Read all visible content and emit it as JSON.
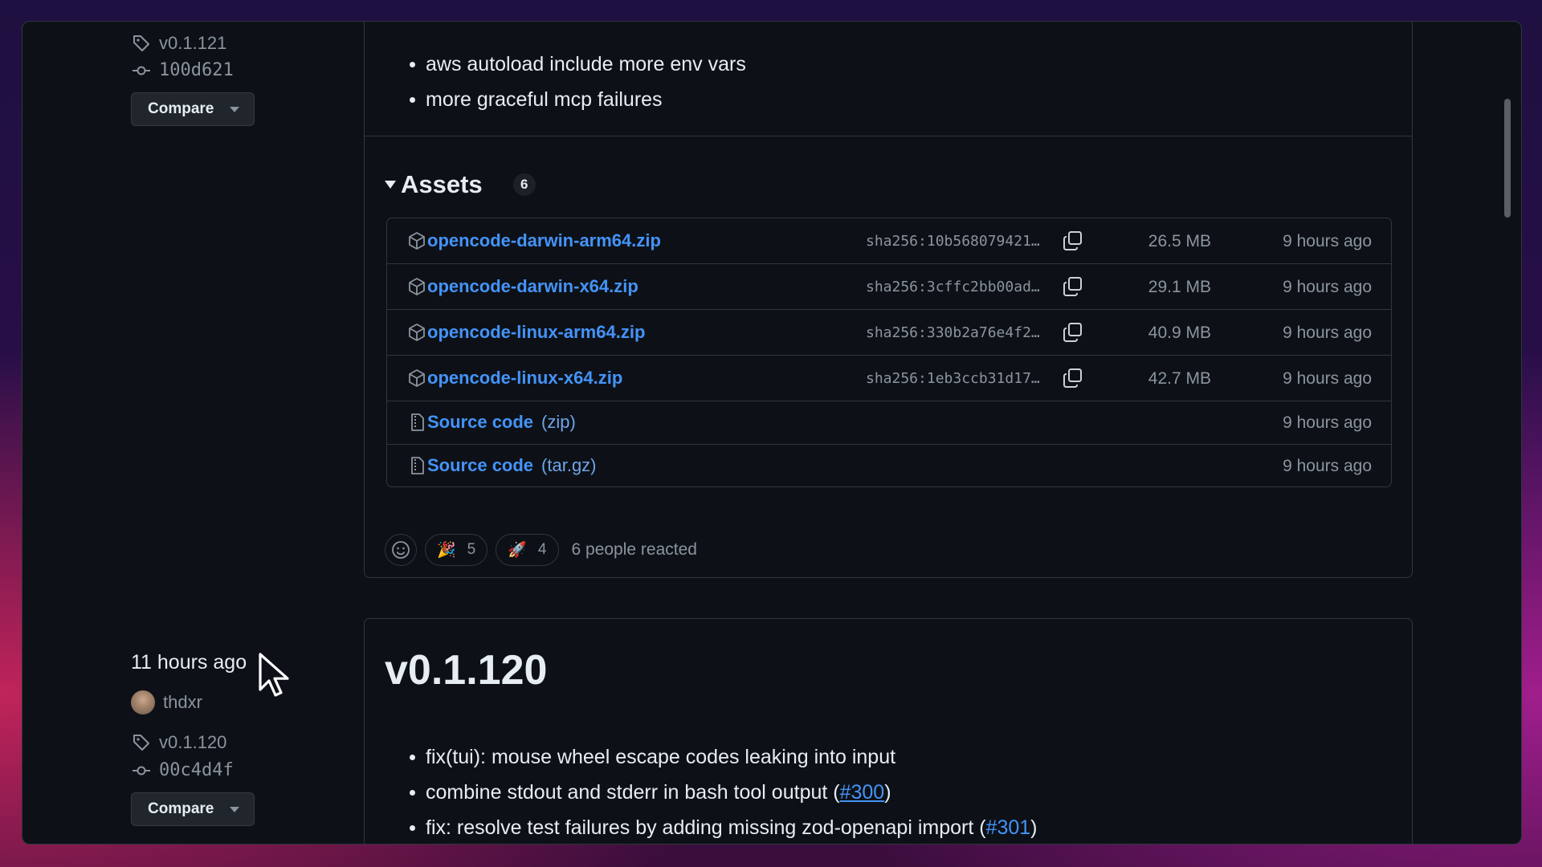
{
  "release_a": {
    "tag": "v0.1.121",
    "commit": "100d621",
    "compare_label": "Compare",
    "notes": [
      "aws autoload include more env vars",
      "more graceful mcp failures"
    ],
    "assets_title": "Assets",
    "assets_count": "6",
    "assets": [
      {
        "name": "opencode-darwin-arm64.zip",
        "sha": "sha256:10b568079421…",
        "size": "26.5 MB",
        "time": "9 hours ago"
      },
      {
        "name": "opencode-darwin-x64.zip",
        "sha": "sha256:3cffc2bb00ad…",
        "size": "29.1 MB",
        "time": "9 hours ago"
      },
      {
        "name": "opencode-linux-arm64.zip",
        "sha": "sha256:330b2a76e4f2…",
        "size": "40.9 MB",
        "time": "9 hours ago"
      },
      {
        "name": "opencode-linux-x64.zip",
        "sha": "sha256:1eb3ccb31d17…",
        "size": "42.7 MB",
        "time": "9 hours ago"
      }
    ],
    "sources": [
      {
        "label": "Source code",
        "suffix": "(zip)",
        "time": "9 hours ago"
      },
      {
        "label": "Source code",
        "suffix": "(tar.gz)",
        "time": "9 hours ago"
      }
    ],
    "reactions": [
      {
        "emoji": "🎉",
        "count": "5"
      },
      {
        "emoji": "🚀",
        "count": "4"
      }
    ],
    "reacted_text": "6 people reacted"
  },
  "release_b": {
    "time": "11 hours ago",
    "author": "thdxr",
    "tag": "v0.1.120",
    "commit": "00c4d4f",
    "compare_label": "Compare",
    "title": "v0.1.120",
    "notes": {
      "n1": "fix(tui): mouse wheel escape codes leaking into input",
      "n2_text": "combine stdout and stderr in bash tool output (",
      "n2_link": "#300",
      "n2_end": ")",
      "n3_text": "fix: resolve test failures by adding missing zod-openapi import (",
      "n3_link": "#301",
      "n3_end": ")"
    }
  },
  "colors": {
    "accent_link": "#4493f8",
    "muted": "#8b949e",
    "bg": "#0d1117",
    "border": "#30363d"
  }
}
